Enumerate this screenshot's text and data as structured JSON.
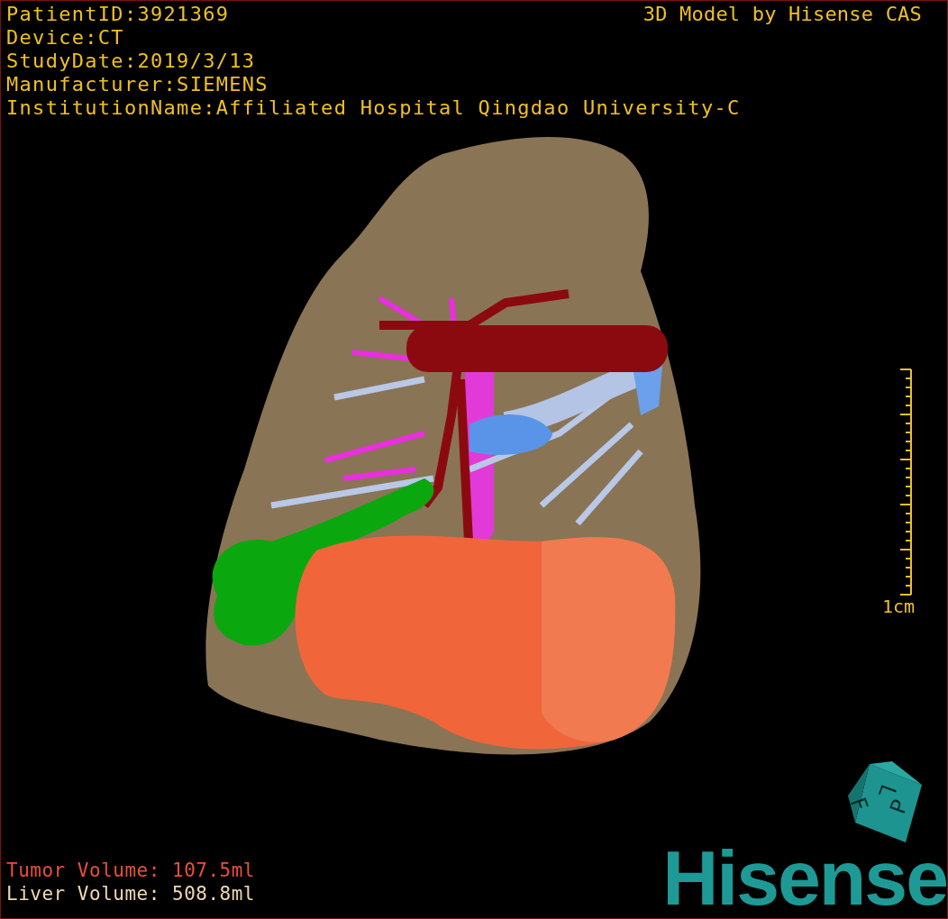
{
  "header_lines": [
    "PatientID:3921369",
    "Device:CT",
    "StudyDate:2019/3/13",
    "Manufacturer:SIEMENS",
    "InstitutionName:Affiliated Hospital Qingdao University-C"
  ],
  "title": "3D Model by Hisense CAS",
  "scale_label": "1cm",
  "volumes": [
    {
      "label": "Tumor Volume:",
      "value": "107.5ml",
      "color": "#e8503a"
    },
    {
      "label": "Liver Volume:",
      "value": "508.8ml",
      "color": "#f0d8b0"
    }
  ],
  "cube_labels": [
    "L",
    "P",
    "F"
  ],
  "logo": "Hisense"
}
